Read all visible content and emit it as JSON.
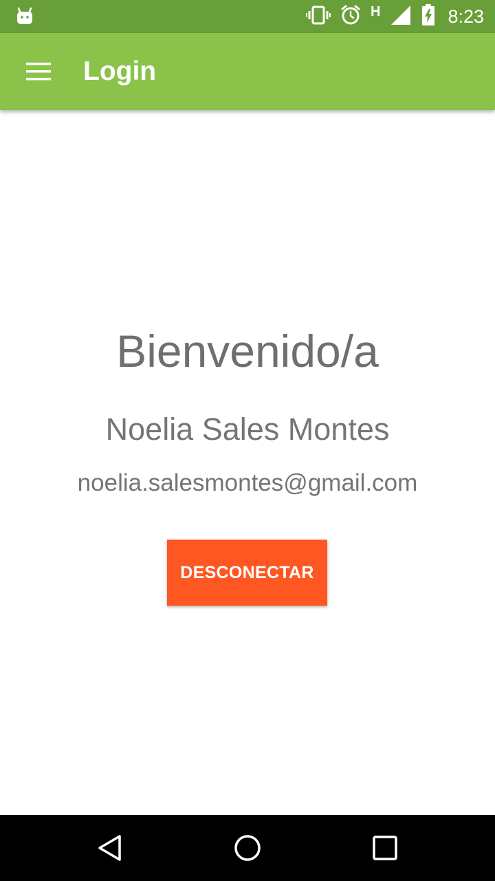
{
  "status_bar": {
    "time": "8:23",
    "network_type": "H",
    "icons": [
      "android-icon",
      "vibrate-icon",
      "alarm-icon",
      "signal-icon",
      "battery-charging-icon"
    ]
  },
  "app_bar": {
    "title": "Login",
    "menu_icon": "hamburger-menu-icon",
    "color": "#8bc34a",
    "status_color": "#689f38"
  },
  "main": {
    "welcome": "Bienvenido/a",
    "user_name": "Noelia Sales Montes",
    "user_email": "noelia.salesmontes@gmail.com",
    "logout_label": "DESCONECTAR",
    "logout_color": "#ff5722"
  },
  "nav_bar": {
    "icons": [
      "back-icon",
      "home-icon",
      "recents-icon"
    ]
  }
}
